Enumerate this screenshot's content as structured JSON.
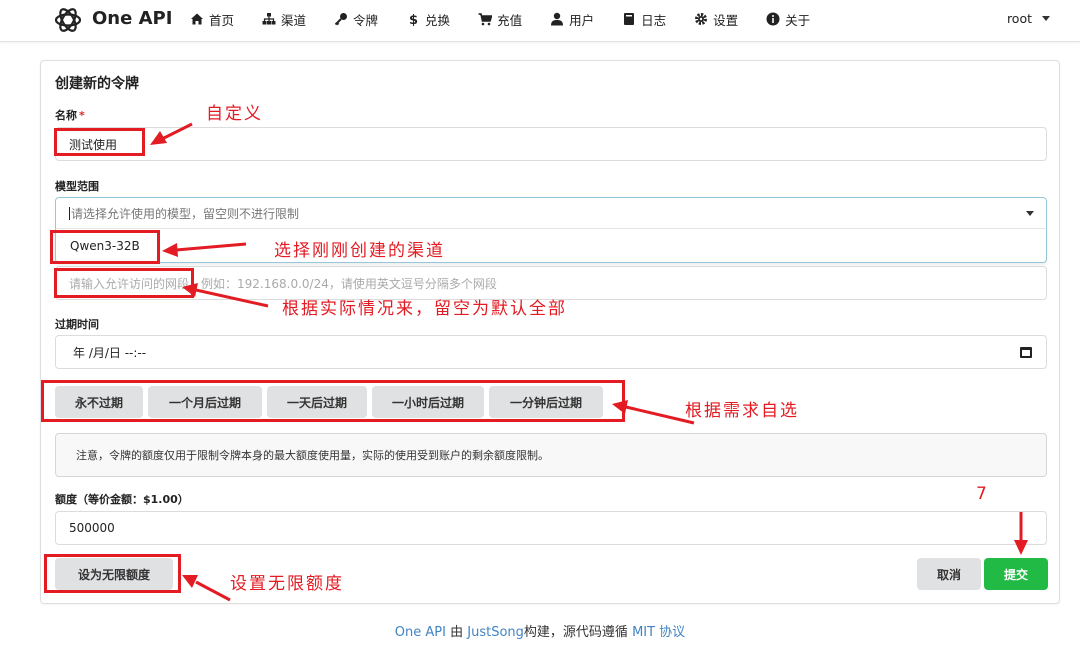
{
  "nav": {
    "brand": "One API",
    "items": [
      {
        "label": "首页",
        "icon": "home-icon"
      },
      {
        "label": "渠道",
        "icon": "sitemap-icon"
      },
      {
        "label": "令牌",
        "icon": "key-icon"
      },
      {
        "label": "兑换",
        "icon": "dollar-icon"
      },
      {
        "label": "充值",
        "icon": "cart-icon"
      },
      {
        "label": "用户",
        "icon": "user-icon"
      },
      {
        "label": "日志",
        "icon": "book-icon"
      },
      {
        "label": "设置",
        "icon": "gear-icon"
      },
      {
        "label": "关于",
        "icon": "info-icon"
      }
    ],
    "user": "root"
  },
  "form": {
    "title": "创建新的令牌",
    "name_label": "名称",
    "name_required": "*",
    "name_value": "测试使用",
    "models_label": "模型范围",
    "models_placeholder": "请选择允许使用的模型，留空则不进行限制",
    "models_option": "Qwen3-32B",
    "subnet_placeholder": "请输入允许访问的网段，例如：192.168.0.0/24，请使用英文逗号分隔多个网段",
    "expire_label": "过期时间",
    "expire_value": "年 /月/日 --:--",
    "expire_buttons": [
      "永不过期",
      "一个月后过期",
      "一天后过期",
      "一小时后过期",
      "一分钟后过期"
    ],
    "notice": "注意，令牌的额度仅用于限制令牌本身的最大额度使用量，实际的使用受到账户的剩余额度限制。",
    "quota_label": "额度（等价金额：$1.00）",
    "quota_value": "500000",
    "unlimited_button": "设为无限额度",
    "cancel_button": "取消",
    "submit_button": "提交"
  },
  "annotations": {
    "name": "自定义",
    "models": "选择刚刚创建的渠道",
    "subnet": "根据实际情况来，留空为默认全部",
    "expire": "根据需求自选",
    "unlimited": "设置无限额度",
    "step": "7"
  },
  "footer": {
    "brand_link": "One API",
    "by": "由",
    "author_link": "JustSong",
    "mid": "构建，源代码遵循",
    "license_link": "MIT 协议"
  },
  "colors": {
    "annotation_red": "#e31b23",
    "submit_green": "#21ba45",
    "link_blue": "#4183c4"
  }
}
